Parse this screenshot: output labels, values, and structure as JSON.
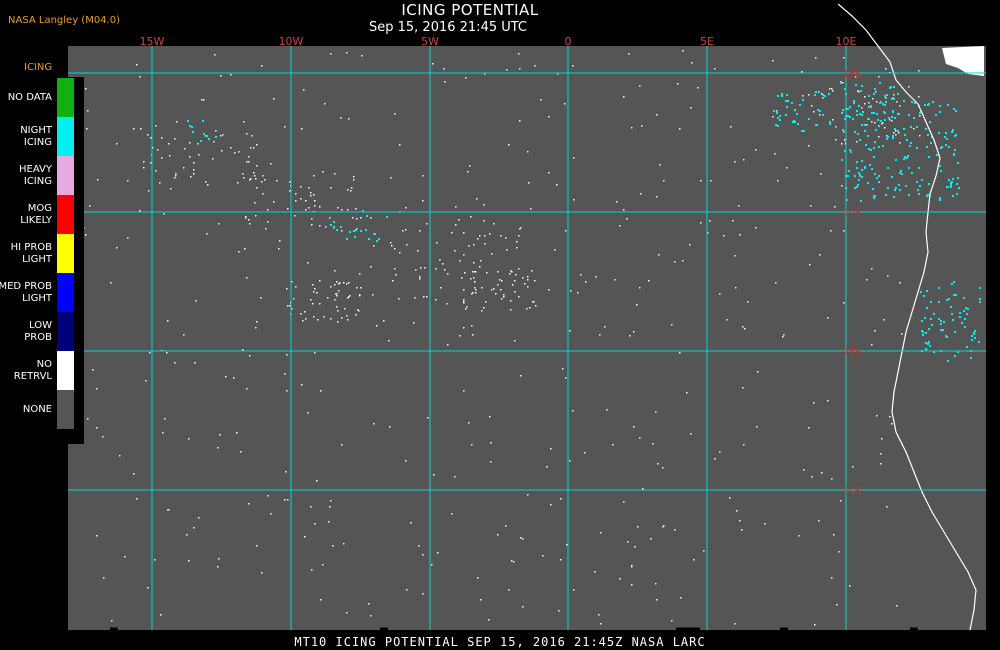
{
  "header": {
    "credit": "NASA Langley (M04.0)",
    "title": "ICING POTENTIAL",
    "subtitle": "Sep 15, 2016 21:45 UTC"
  },
  "footer": {
    "text": "MT10  ICING POTENTIAL   SEP 15, 2016 21:45Z   NASA LARC"
  },
  "map": {
    "background_color": "#555555",
    "grid_color": "#00d8d8",
    "coast_color": "#ffffff",
    "longitude_labels": [
      "15W",
      "10W",
      "5W",
      "0",
      "5E",
      "10E"
    ],
    "latitude_labels": [
      "15S",
      "20S",
      "25S",
      "30S"
    ]
  },
  "legend": {
    "title": "ICING",
    "items": [
      {
        "label": [
          "NO DATA"
        ],
        "color": "#10b010"
      },
      {
        "label": [
          "NIGHT",
          "ICING"
        ],
        "color": "#00f0f0"
      },
      {
        "label": [
          "HEAVY",
          "ICING"
        ],
        "color": "#e8a8e0"
      },
      {
        "label": [
          "MOG",
          "LIKELY"
        ],
        "color": "#ff0000"
      },
      {
        "label": [
          "HI PROB",
          "LIGHT"
        ],
        "color": "#ffff00"
      },
      {
        "label": [
          "MED PROB",
          "LIGHT"
        ],
        "color": "#0000ff"
      },
      {
        "label": [
          "LOW",
          "PROB"
        ],
        "color": "#00007a"
      },
      {
        "label": [
          "NO",
          "RETRVL"
        ],
        "color": "#ffffff"
      },
      {
        "label": [
          "NONE"
        ],
        "color": "#555555"
      }
    ]
  }
}
